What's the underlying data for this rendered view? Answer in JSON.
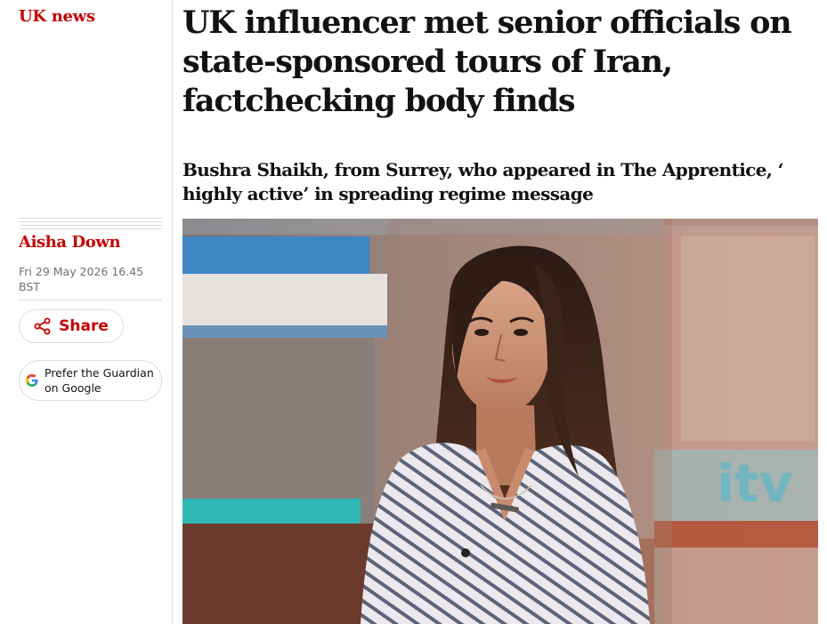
{
  "section": {
    "label": "UK news"
  },
  "article": {
    "headline": "UK influencer met senior officials on state-sponsored tours of Iran, factchecking body finds",
    "standfirst": "Bushra Shaikh, from Surrey, who appeared in The Apprentice, ‘ highly active’ in spreading regime message"
  },
  "byline": {
    "author": "Aisha Down",
    "date": "Fri 29 May 2026 16.45 BST"
  },
  "actions": {
    "share_label": "Share",
    "share_icon": "share-icon",
    "google_label": "Prefer the Guardian on Google",
    "google_icon": "google-g-icon"
  },
  "colors": {
    "accent": "#c70000",
    "text": "#121212",
    "muted": "#707070",
    "border": "#dcdcdc"
  }
}
